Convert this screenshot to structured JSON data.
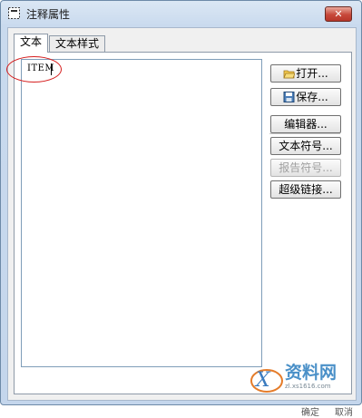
{
  "window": {
    "title": "注释属性",
    "close_glyph": "✕"
  },
  "tabs": [
    {
      "label": "文本",
      "active": true
    },
    {
      "label": "文本样式",
      "active": false
    }
  ],
  "editor": {
    "value": "ITEM"
  },
  "buttons": {
    "open": "打开...",
    "save": "保存...",
    "editor": "编辑器...",
    "text_symbol": "文本符号...",
    "report_symbol": "报告符号...",
    "hyperlink": "超级链接..."
  },
  "footer": {
    "partial_button": "确定",
    "partial_button_2": "取消"
  },
  "watermark": {
    "brand": "资料网",
    "url": "zl.xs1616.com"
  },
  "colors": {
    "annotation_ellipse": "#d61e1e",
    "titlebar": "#c9daee",
    "close_button": "#c7483a"
  }
}
